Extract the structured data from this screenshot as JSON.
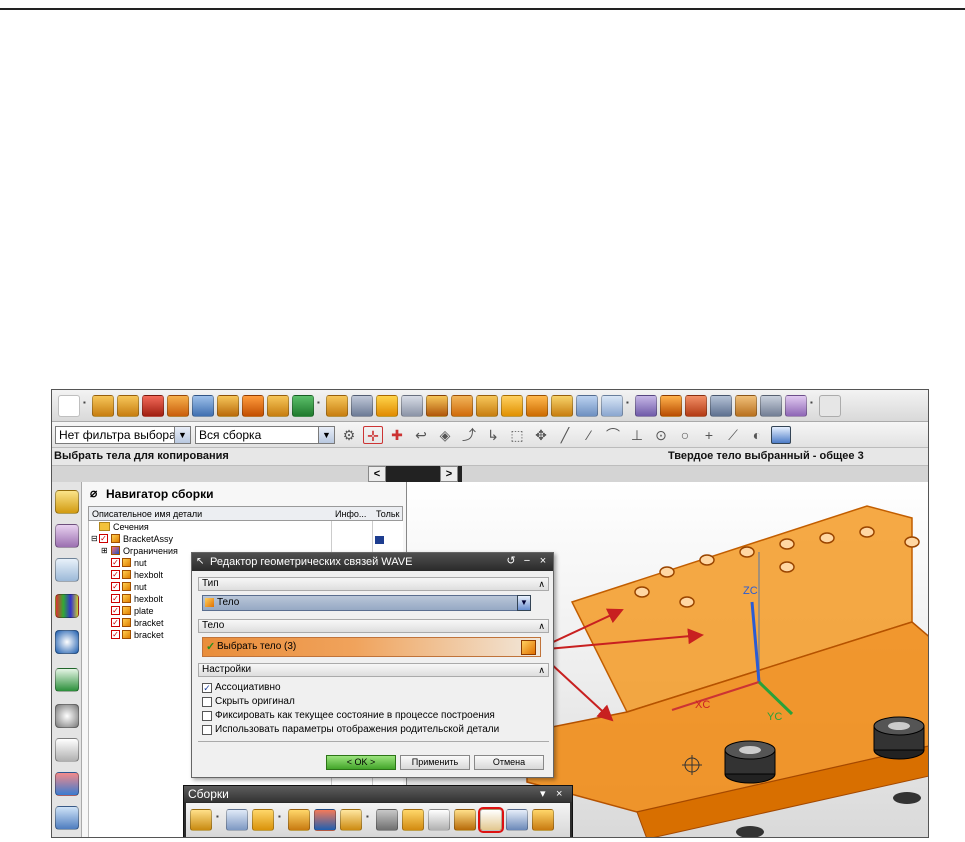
{
  "toolbar": {
    "filter_value": "Нет фильтра выбора",
    "scope_value": "Вся сборка"
  },
  "status": {
    "prompt": "Выбрать тела для копирования",
    "selection": "Твердое тело выбранный - общее 3"
  },
  "navigator": {
    "title": "Навигатор сборки",
    "columns": [
      "Описательное имя детали",
      "Инфо...",
      "Тольк"
    ],
    "rows": [
      {
        "label": "Сечения",
        "level": 0
      },
      {
        "label": "BracketAssy",
        "level": 0
      },
      {
        "label": "Ограничения",
        "level": 1
      },
      {
        "label": "nut",
        "level": 2
      },
      {
        "label": "hexbolt",
        "level": 2
      },
      {
        "label": "nut",
        "level": 2
      },
      {
        "label": "hexbolt",
        "level": 2
      },
      {
        "label": "plate",
        "level": 2
      },
      {
        "label": "bracket",
        "level": 2
      },
      {
        "label": "bracket",
        "level": 2
      }
    ]
  },
  "dialog": {
    "title": "Редактор геометрических связей WAVE",
    "type_section": "Тип",
    "type_value": "Тело",
    "body_section": "Тело",
    "select_body": "Выбрать тело (3)",
    "settings_section": "Настройки",
    "options": [
      {
        "label": "Ассоциативно",
        "checked": true
      },
      {
        "label": "Скрыть оригинал",
        "checked": false
      },
      {
        "label": "Фиксировать как текущее состояние в процессе построения",
        "checked": false
      },
      {
        "label": "Использовать параметры отображения родительской детали",
        "checked": false
      }
    ],
    "ok": "< OK >",
    "apply": "Применить",
    "cancel": "Отмена"
  },
  "assemblies_toolbar": {
    "title": "Сборки"
  },
  "viewport": {
    "axis_x": "XC",
    "axis_y": "YC",
    "axis_z": "ZC"
  },
  "colors": {
    "part_orange": "#f08a12",
    "arrow_red": "#c82020",
    "ok_green": "#43a52a"
  }
}
